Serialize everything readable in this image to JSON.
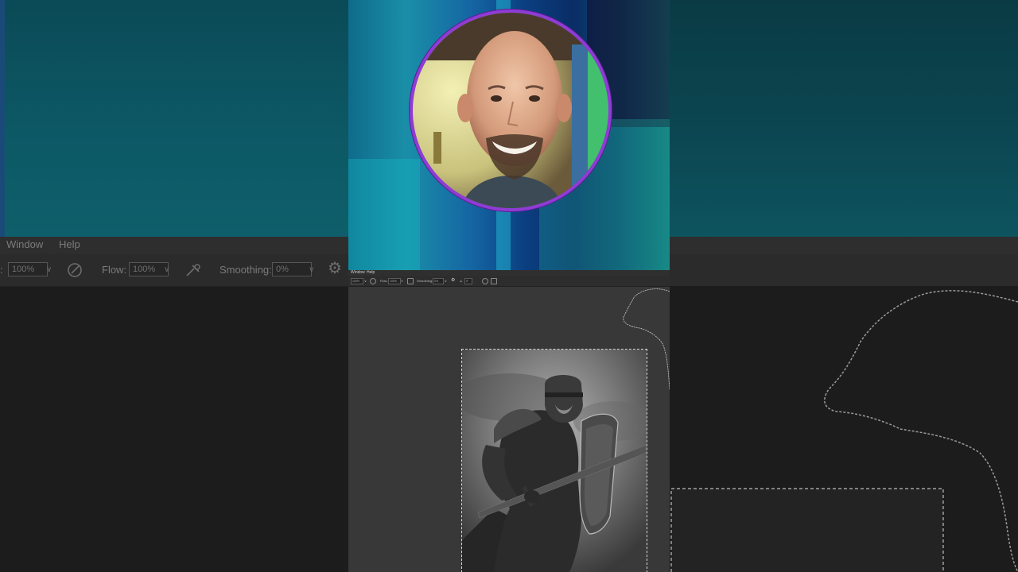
{
  "background_left": {
    "menu": [
      "Window",
      "Help"
    ],
    "options": {
      "opacity_value": "100%",
      "flow_label": "Flow:",
      "flow_value": "100%",
      "smoothing_label": "Smoothing:",
      "smoothing_value": "0%"
    }
  },
  "center": {
    "menu": [
      "Window",
      "Help"
    ],
    "options": {
      "opacity_value": "100%",
      "flow_label": "Flow:",
      "flow_value": "100%",
      "smoothing_label": "Smoothing:",
      "smoothing_value": "0%",
      "angle_value": "0°"
    }
  },
  "colors": {
    "webcam_border": "#8f3bd6",
    "ps_panel": "#2d2d2d",
    "ps_canvas": "#383838",
    "selection_marquee": "#d8d8d8"
  },
  "icons": [
    "brush-pressure-icon",
    "airbrush-icon",
    "gear-icon",
    "symmetry-icon"
  ]
}
